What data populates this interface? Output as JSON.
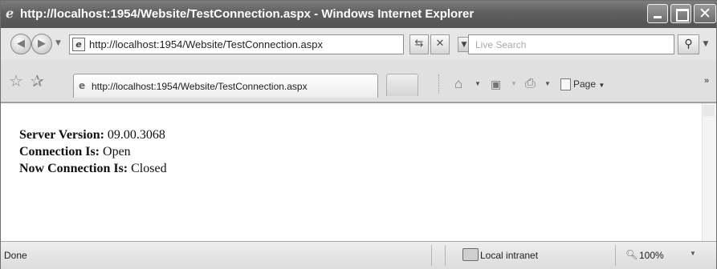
{
  "window": {
    "title": "http://localhost:1954/Website/TestConnection.aspx - Windows Internet Explorer",
    "ie_icon": "ie-page-icon"
  },
  "toolbar": {
    "address": "http://localhost:1954/Website/TestConnection.aspx",
    "search_placeholder": "Live Search",
    "back_icon": "back-arrow-icon",
    "forward_icon": "forward-arrow-icon",
    "refresh_icon": "refresh-icon",
    "stop_icon": "stop-x-icon",
    "search_icon": "magnifier-icon"
  },
  "tabs": {
    "active_tab_label": "http://localhost:1954/Website/TestConnection.aspx"
  },
  "commands": {
    "page_label": "Page",
    "more": "»"
  },
  "content": {
    "lines": [
      {
        "label": "Server Version:",
        "value": " 09.00.3068"
      },
      {
        "label": "Connection Is:",
        "value": " Open"
      },
      {
        "label": "Now Connection Is:",
        "value": " Closed"
      }
    ]
  },
  "status": {
    "left_text": "Done",
    "zone": "Local intranet",
    "zoom": "100%"
  }
}
